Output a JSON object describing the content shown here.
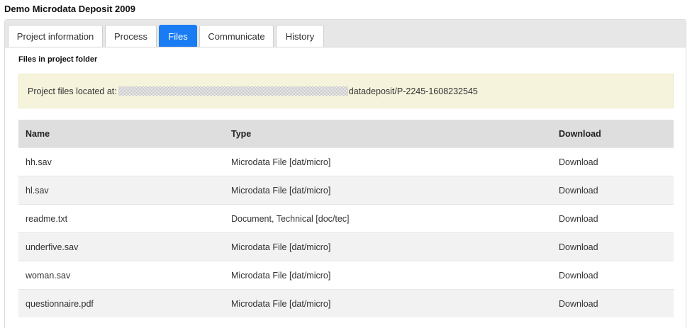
{
  "page": {
    "title": "Demo Microdata Deposit 2009"
  },
  "tabs": [
    {
      "label": "Project information",
      "active": false
    },
    {
      "label": "Process",
      "active": false
    },
    {
      "label": "Files",
      "active": true
    },
    {
      "label": "Communicate",
      "active": false
    },
    {
      "label": "History",
      "active": false
    }
  ],
  "files_section": {
    "title": "Files in project folder",
    "location_prefix": "Project files located at:",
    "location_path": "datadeposit/P-2245-1608232545"
  },
  "table": {
    "headers": {
      "name": "Name",
      "type": "Type",
      "download": "Download"
    },
    "rows": [
      {
        "name": "hh.sav",
        "type": "Microdata File [dat/micro]",
        "download": "Download"
      },
      {
        "name": "hl.sav",
        "type": "Microdata File [dat/micro]",
        "download": "Download"
      },
      {
        "name": "readme.txt",
        "type": "Document, Technical [doc/tec]",
        "download": "Download"
      },
      {
        "name": "underfive.sav",
        "type": "Microdata File [dat/micro]",
        "download": "Download"
      },
      {
        "name": "woman.sav",
        "type": "Microdata File [dat/micro]",
        "download": "Download"
      },
      {
        "name": "questionnaire.pdf",
        "type": "Microdata File [dat/micro]",
        "download": "Download"
      }
    ]
  },
  "colors": {
    "active_tab": "#1a7cf3",
    "tab_bar": "#e7e7e7",
    "location_background": "#f5f3dc",
    "table_header": "#dedede",
    "row_stripe": "#f2f2f2"
  }
}
